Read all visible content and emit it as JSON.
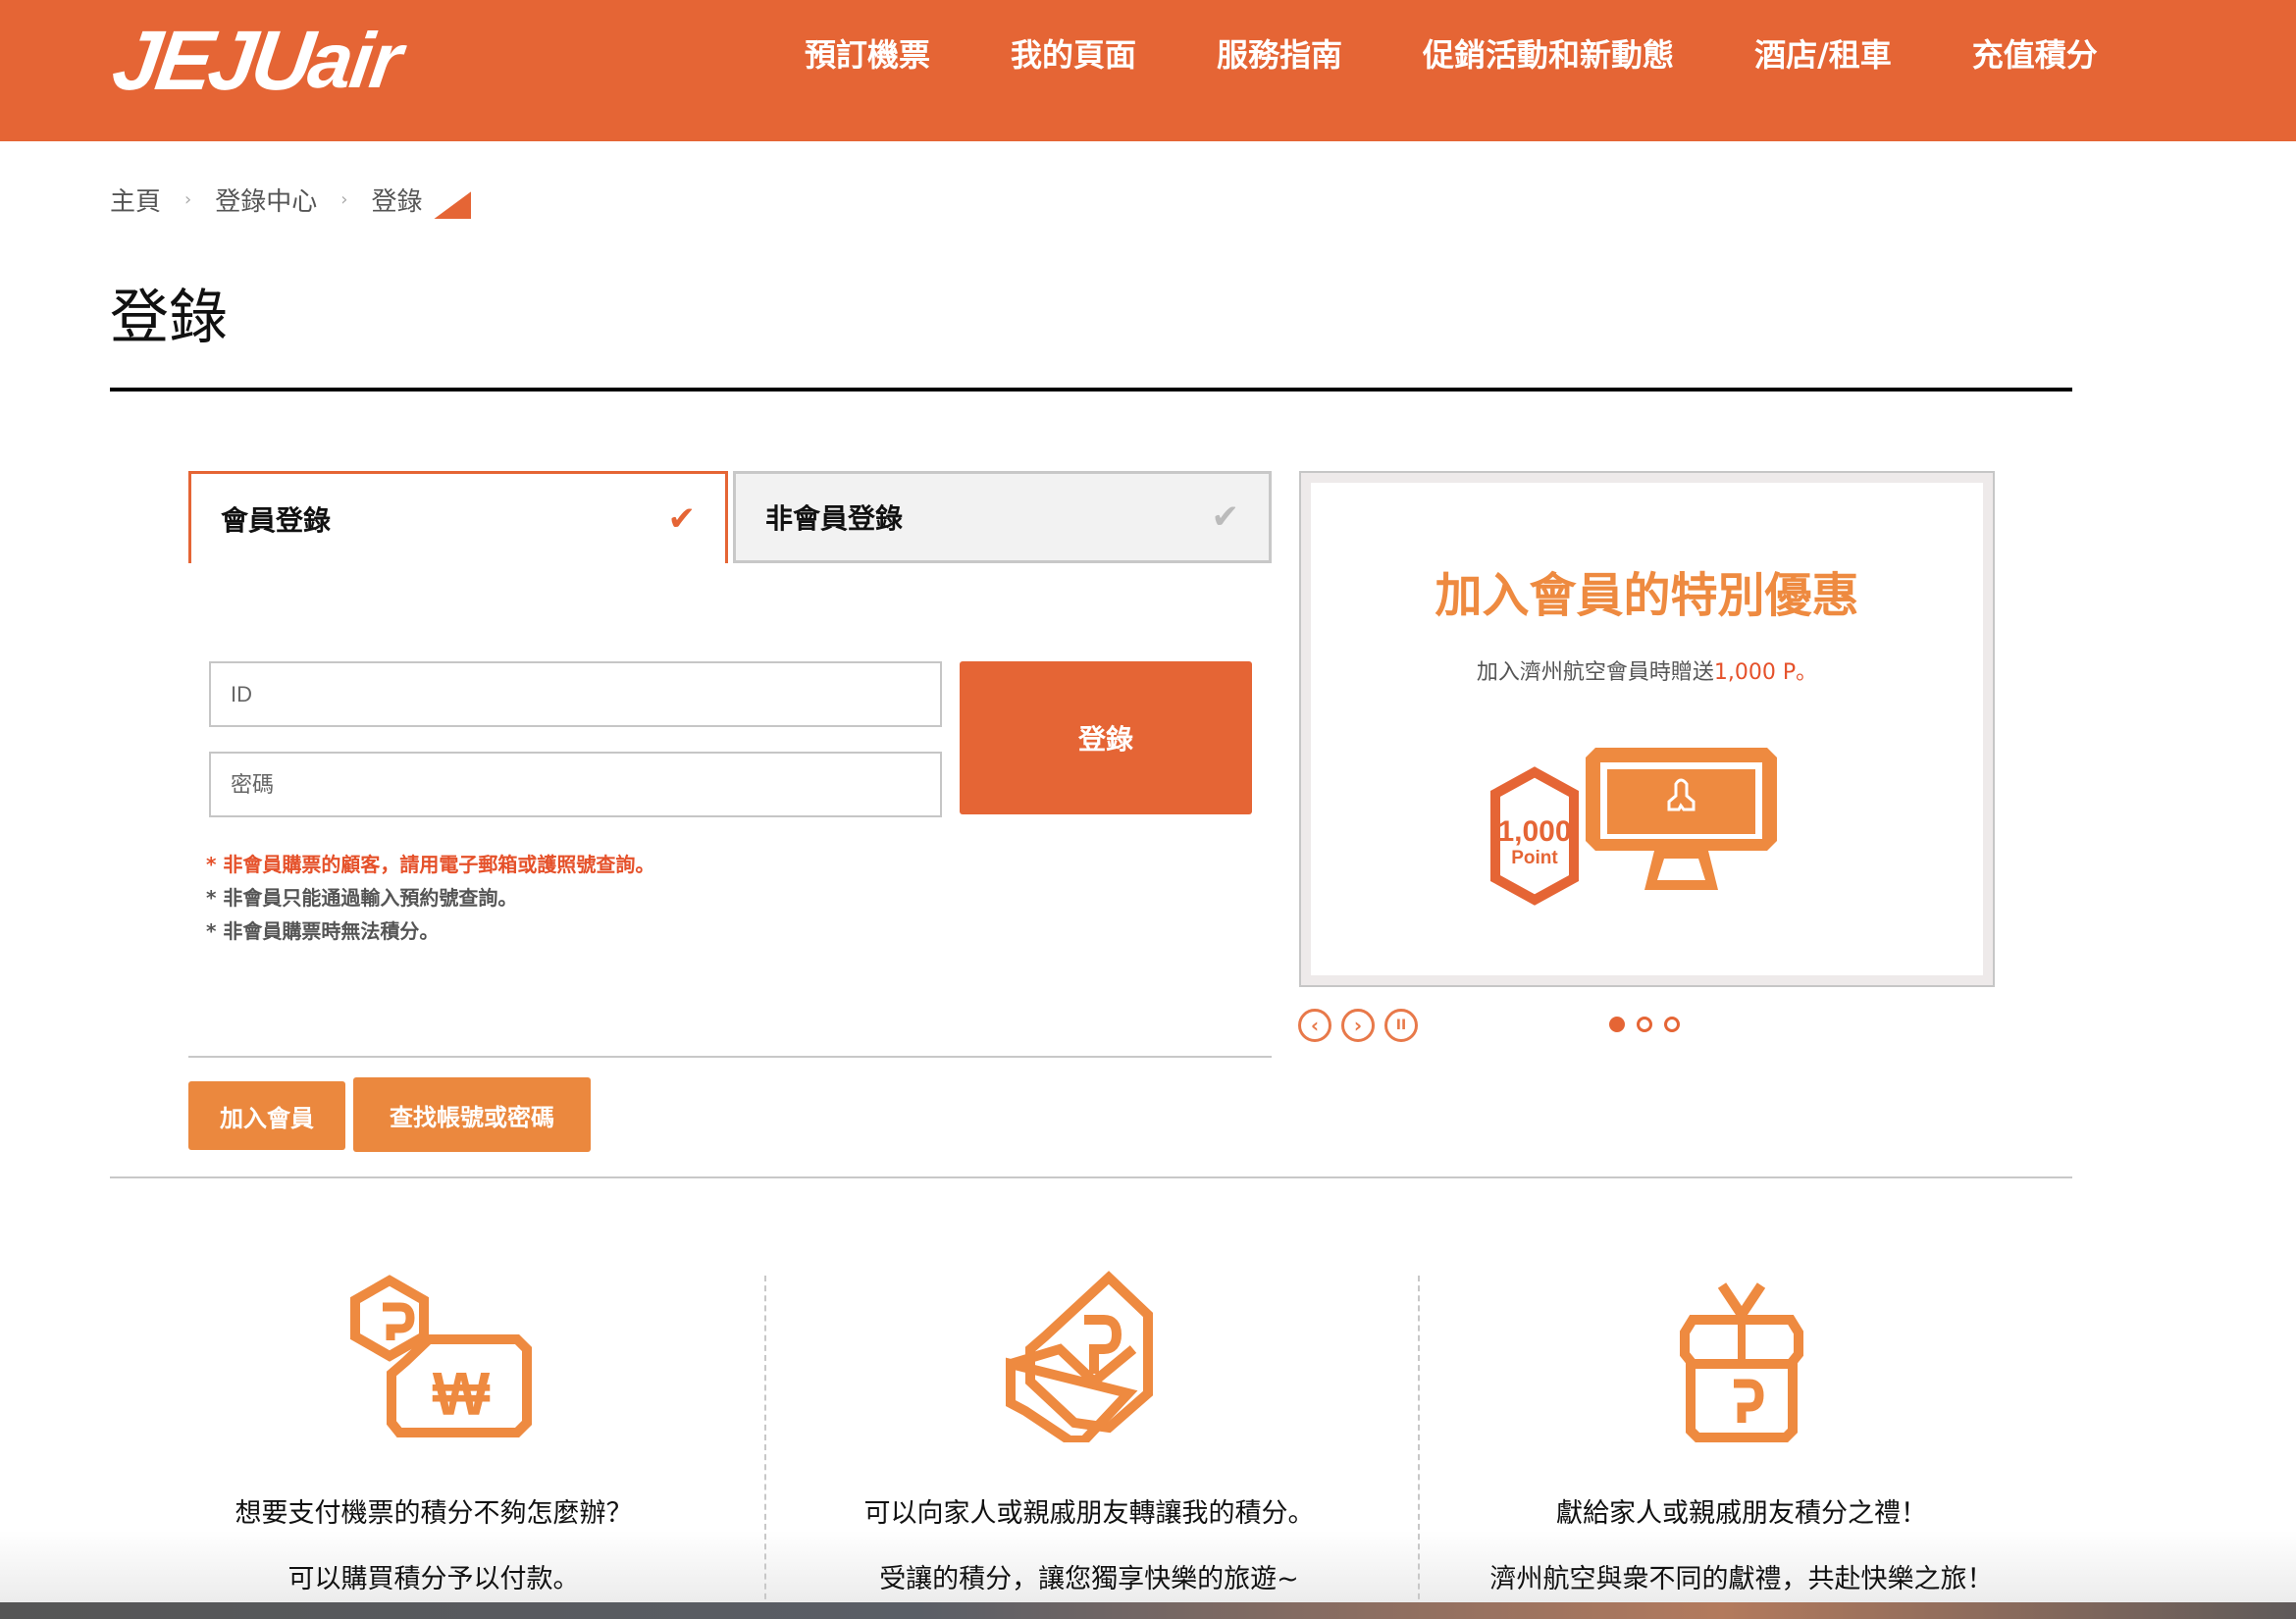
{
  "brand": {
    "logo_main": "JEJU",
    "logo_suffix": "air",
    "accent_color": "#e56535"
  },
  "nav": {
    "items": [
      "預訂機票",
      "我的頁面",
      "服務指南",
      "促銷活動和新動態",
      "酒店/租車",
      "充值積分"
    ]
  },
  "breadcrumb": {
    "items": [
      "主頁",
      "登錄中心",
      "登錄"
    ],
    "separator": "›"
  },
  "page": {
    "title": "登錄"
  },
  "tabs": [
    {
      "label": "會員登錄",
      "active": true,
      "icon": "check-icon"
    },
    {
      "label": "非會員登錄",
      "active": false,
      "icon": "check-icon"
    }
  ],
  "form": {
    "id_placeholder": "ID",
    "id_value": "",
    "password_placeholder": "密碼",
    "password_value": "",
    "login_label": "登錄"
  },
  "notes": [
    "* 非會員購票的顧客，請用電子郵箱或護照號查詢。",
    "* 非會員只能通過輸入預約號查詢。",
    "* 非會員購票時無法積分。"
  ],
  "actions": {
    "join_label": "加入會員",
    "find_label": "查找帳號或密碼"
  },
  "promo": {
    "title": "加入會員的特別優惠",
    "subtitle_prefix": "加入濟州航空會員時贈送",
    "subtitle_highlight": "1,000 P。",
    "badge_amount": "1,000",
    "badge_unit": "Point",
    "controls": {
      "prev": "‹",
      "next": "›",
      "pause": "II"
    },
    "slide_count": 3,
    "active_slide": 1
  },
  "features": [
    {
      "icon": "points-to-won-icon",
      "line1": "想要支付機票的積分不夠怎麼辦？",
      "line2": "可以購買積分予以付款。"
    },
    {
      "icon": "hand-points-icon",
      "line1": "可以向家人或親戚朋友轉讓我的積分。",
      "line2": "受讓的積分，讓您獨享快樂的旅遊~"
    },
    {
      "icon": "gift-points-icon",
      "line1": "獻給家人或親戚朋友積分之禮！",
      "line2": "濟州航空與衆不同的獻禮，共赴快樂之旅！"
    }
  ]
}
